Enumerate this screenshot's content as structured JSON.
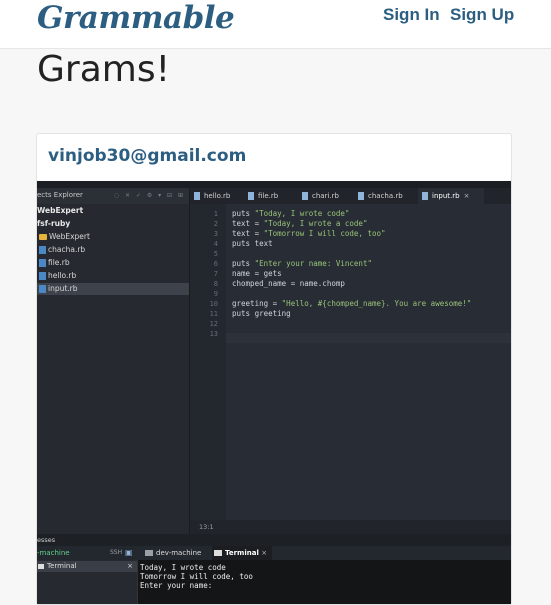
{
  "nav": {
    "brand": "Grammable",
    "sign_in": "Sign In",
    "sign_up": "Sign Up",
    "brand_color": "#2c5e82"
  },
  "page": {
    "title": "Grams!"
  },
  "card": {
    "email": "vinjob30@gmail.com",
    "screenshot": {
      "explorer": {
        "title": "ects Explorer",
        "items": [
          {
            "label": "WebExpert",
            "kind": "root"
          },
          {
            "label": "fsf-ruby",
            "kind": "root"
          },
          {
            "label": "WebExpert",
            "kind": "folder"
          },
          {
            "label": "chacha.rb",
            "kind": "file"
          },
          {
            "label": "file.rb",
            "kind": "file"
          },
          {
            "label": "hello.rb",
            "kind": "file"
          },
          {
            "label": "input.rb",
            "kind": "file-selected"
          }
        ]
      },
      "tabs": [
        "hello.rb",
        "file.rb",
        "chari.rb",
        "chacha.rb",
        "input.rb"
      ],
      "active_tab_close": "×",
      "line_numbers": [
        "1",
        "2",
        "3",
        "4",
        "5",
        "6",
        "7",
        "8",
        "9",
        "10",
        "11",
        "12",
        "13"
      ],
      "code_lines": [
        {
          "a": "puts ",
          "s": "\"Today, I wrote code\"",
          "b": ""
        },
        {
          "a": "text = ",
          "s": "\"Today, I wrote a code\"",
          "b": ""
        },
        {
          "a": "text = ",
          "s": "\"Tomorrow I will code, too\"",
          "b": ""
        },
        {
          "a": "puts text",
          "s": "",
          "b": ""
        },
        {
          "a": "",
          "s": "",
          "b": ""
        },
        {
          "a": "puts ",
          "s": "\"Enter your name: Vincent\"",
          "b": ""
        },
        {
          "a": "name = gets",
          "s": "",
          "b": ""
        },
        {
          "a": "chomped_name = name.chomp",
          "s": "",
          "b": ""
        },
        {
          "a": "",
          "s": "",
          "b": ""
        },
        {
          "a": "greeting = ",
          "s": "\"Hello, #{chomped_name}. You are awesome!\"",
          "b": ""
        },
        {
          "a": "puts greeting",
          "s": "",
          "b": ""
        },
        {
          "a": "",
          "s": "",
          "b": ""
        },
        {
          "a": "",
          "s": "",
          "b": ""
        }
      ],
      "status": "13:1",
      "processes_title": "esses",
      "machine_label": "-machine",
      "ssh_label": "SSH",
      "bottom_tab_devmachine": "dev-machine",
      "bottom_tab_terminal": "Terminal",
      "terminal_close": "×",
      "side_terminal": "Terminal",
      "side_close": "×",
      "terminal_lines": [
        "Today, I wrote code",
        "Tomorrow I will code, too",
        "Enter your name:"
      ]
    }
  }
}
